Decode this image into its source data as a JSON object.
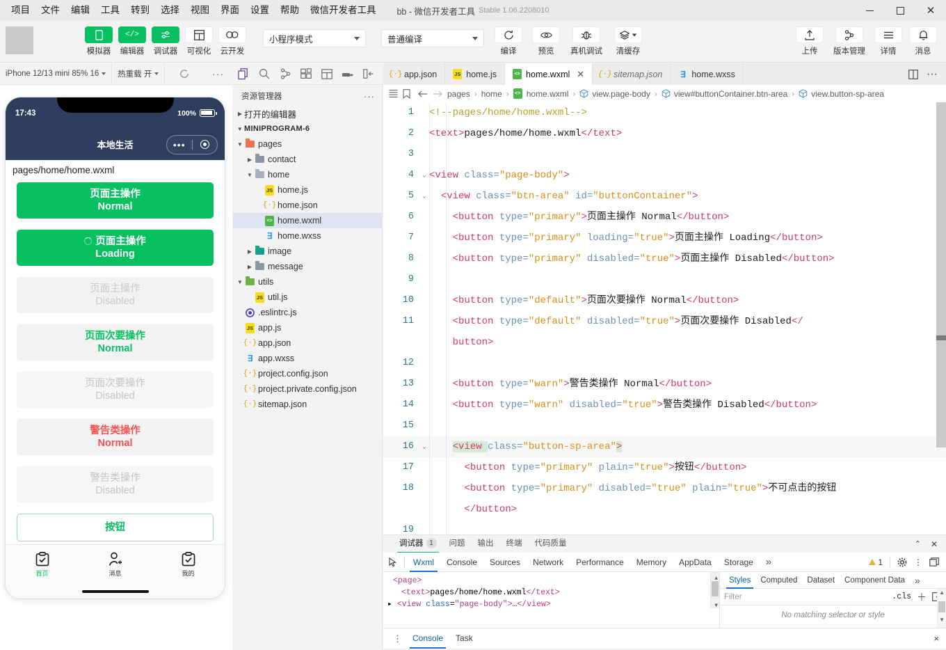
{
  "window": {
    "title": "bb - 微信开发者工具",
    "version": "Stable 1.06.2208010",
    "minimize": "minimize",
    "maximize": "maximize",
    "close": "close"
  },
  "menubar": {
    "items": [
      "项目",
      "文件",
      "编辑",
      "工具",
      "转到",
      "选择",
      "视图",
      "界面",
      "设置",
      "帮助",
      "微信开发者工具"
    ]
  },
  "toolbar": {
    "left_items": [
      {
        "label": "模拟器",
        "icon": "phone-icon",
        "style": "green"
      },
      {
        "label": "编辑器",
        "icon": "code-icon",
        "style": "green"
      },
      {
        "label": "调试器",
        "icon": "sliders-icon",
        "style": "green"
      },
      {
        "label": "可视化",
        "icon": "layout-icon",
        "style": "white"
      },
      {
        "label": "云开发",
        "icon": "cloud-icon",
        "style": "white"
      }
    ],
    "mode_select": "小程序模式",
    "compile_select": "普通编译",
    "mid_items": [
      {
        "label": "编译",
        "icon": "refresh-icon"
      },
      {
        "label": "预览",
        "icon": "eye-icon"
      },
      {
        "label": "真机调试",
        "icon": "bug-icon"
      },
      {
        "label": "清缓存",
        "icon": "layers-icon"
      }
    ],
    "right_items": [
      {
        "label": "上传",
        "icon": "upload-icon"
      },
      {
        "label": "版本管理",
        "icon": "branch-icon"
      },
      {
        "label": "详情",
        "icon": "menu-icon"
      },
      {
        "label": "消息",
        "icon": "bell-icon"
      }
    ]
  },
  "simulator": {
    "device_select": "iPhone 12/13 mini 85% 16",
    "hot_reload_select": "热重载 开",
    "refresh_icon": "refresh-icon",
    "more_icon": "ellipsis-icon",
    "status_time": "17:43",
    "battery_pct": "100%",
    "nav_title": "本地生活",
    "page_path": "pages/home/home.wxml",
    "buttons": [
      {
        "line1": "页面主操作",
        "line2": "Normal",
        "style": "primary",
        "loading": false
      },
      {
        "line1": "页面主操作",
        "line2": "Loading",
        "style": "primary",
        "loading": true
      },
      {
        "line1": "页面主操作",
        "line2": "Disabled",
        "style": "primary-dis",
        "loading": false
      },
      {
        "line1": "页面次要操作",
        "line2": "Normal",
        "style": "default",
        "loading": false
      },
      {
        "line1": "页面次要操作",
        "line2": "Disabled",
        "style": "default-dis",
        "loading": false
      },
      {
        "line1": "警告类操作",
        "line2": "Normal",
        "style": "warn",
        "loading": false
      },
      {
        "line1": "警告类操作",
        "line2": "Disabled",
        "style": "warn-dis",
        "loading": false
      }
    ],
    "plain_button": "按钮",
    "tabbar": [
      {
        "label": "首页",
        "icon": "clipboard-check-icon",
        "active": true
      },
      {
        "label": "消息",
        "icon": "person-add-icon",
        "active": false
      },
      {
        "label": "我的",
        "icon": "clipboard-check-icon",
        "active": false
      }
    ]
  },
  "activity_bar": {
    "icons": [
      "files-icon",
      "search-icon",
      "source-control-icon",
      "extensions-icon",
      "layout-panel-icon",
      "docker-icon",
      "sidebar-toggle-icon"
    ]
  },
  "explorer": {
    "title": "资源管理器",
    "more": "···",
    "open_editors": "打开的编辑器",
    "project_name": "MINIPROGRAM-6",
    "tree": [
      {
        "label": "pages",
        "depth": 1,
        "type": "folder",
        "color": "f-red",
        "expanded": true
      },
      {
        "label": "contact",
        "depth": 2,
        "type": "folder",
        "color": "f-gray",
        "expanded": false
      },
      {
        "label": "home",
        "depth": 2,
        "type": "folder",
        "color": "f-lgray",
        "expanded": true
      },
      {
        "label": "home.js",
        "depth": 3,
        "type": "js"
      },
      {
        "label": "home.json",
        "depth": 3,
        "type": "json"
      },
      {
        "label": "home.wxml",
        "depth": 3,
        "type": "wxml",
        "selected": true
      },
      {
        "label": "home.wxss",
        "depth": 3,
        "type": "wxss"
      },
      {
        "label": "image",
        "depth": 2,
        "type": "folder",
        "color": "f-teal",
        "expanded": false
      },
      {
        "label": "message",
        "depth": 2,
        "type": "folder",
        "color": "f-gray",
        "expanded": false
      },
      {
        "label": "utils",
        "depth": 1,
        "type": "folder",
        "color": "f-green",
        "expanded": true
      },
      {
        "label": "util.js",
        "depth": 2,
        "type": "js"
      },
      {
        "label": ".eslintrc.js",
        "depth": 1,
        "type": "eslint"
      },
      {
        "label": "app.js",
        "depth": 1,
        "type": "js"
      },
      {
        "label": "app.json",
        "depth": 1,
        "type": "json"
      },
      {
        "label": "app.wxss",
        "depth": 1,
        "type": "wxss"
      },
      {
        "label": "project.config.json",
        "depth": 1,
        "type": "json"
      },
      {
        "label": "project.private.config.json",
        "depth": 1,
        "type": "json"
      },
      {
        "label": "sitemap.json",
        "depth": 1,
        "type": "json"
      }
    ]
  },
  "editor": {
    "tabs": [
      {
        "label": "app.json",
        "type": "json",
        "active": false,
        "italic": false,
        "closable": false
      },
      {
        "label": "home.js",
        "type": "js",
        "active": false,
        "italic": false,
        "closable": false
      },
      {
        "label": "home.wxml",
        "type": "wxml",
        "active": true,
        "italic": false,
        "closable": true
      },
      {
        "label": "sitemap.json",
        "type": "json",
        "active": false,
        "italic": true,
        "closable": false
      },
      {
        "label": "home.wxss",
        "type": "wxss",
        "active": false,
        "italic": false,
        "closable": false
      }
    ],
    "tab_actions": [
      "split-editor-icon",
      "more-actions-icon"
    ],
    "breadcrumb_icons": [
      "outline-icon",
      "bookmark-icon",
      "back-arrow-icon",
      "forward-arrow-icon"
    ],
    "breadcrumb": [
      "pages",
      "home",
      "home.wxml",
      "view.page-body",
      "view#buttonContainer.btn-area",
      "view.button-sp-area"
    ],
    "lines": [
      {
        "num": "1",
        "fold": "",
        "tokens": [
          {
            "t": "comment",
            "v": "<!--pages/home/home.wxml-->"
          }
        ]
      },
      {
        "num": "2",
        "fold": "",
        "tokens": [
          {
            "t": "tag",
            "v": "<text>"
          },
          {
            "t": "text",
            "v": "pages/home/home.wxml"
          },
          {
            "t": "tag",
            "v": "</text>"
          }
        ]
      },
      {
        "num": "3",
        "fold": "",
        "tokens": []
      },
      {
        "num": "4",
        "fold": "v",
        "tokens": [
          {
            "t": "tag",
            "v": "<view "
          },
          {
            "t": "attr",
            "v": "class="
          },
          {
            "t": "str",
            "v": "\"page-body\""
          },
          {
            "t": "tag",
            "v": ">"
          }
        ]
      },
      {
        "num": "5",
        "fold": "v",
        "indent": 1,
        "tokens": [
          {
            "t": "tag",
            "v": "<view "
          },
          {
            "t": "attr",
            "v": "class="
          },
          {
            "t": "str",
            "v": "\"btn-area\""
          },
          {
            "t": "attr",
            "v": " id="
          },
          {
            "t": "str",
            "v": "\"buttonContainer\""
          },
          {
            "t": "tag",
            "v": ">"
          }
        ]
      },
      {
        "num": "6",
        "fold": "",
        "indent": 2,
        "tokens": [
          {
            "t": "tag",
            "v": "<button "
          },
          {
            "t": "attr",
            "v": "type="
          },
          {
            "t": "str",
            "v": "\"primary\""
          },
          {
            "t": "tag",
            "v": ">"
          },
          {
            "t": "text",
            "v": "页面主操作 Normal"
          },
          {
            "t": "tag",
            "v": "</button>"
          }
        ]
      },
      {
        "num": "7",
        "fold": "",
        "indent": 2,
        "tokens": [
          {
            "t": "tag",
            "v": "<button "
          },
          {
            "t": "attr",
            "v": "type="
          },
          {
            "t": "str",
            "v": "\"primary\""
          },
          {
            "t": "attr",
            "v": " loading="
          },
          {
            "t": "str",
            "v": "\"true\""
          },
          {
            "t": "tag",
            "v": ">"
          },
          {
            "t": "text",
            "v": "页面主操作 Loading"
          },
          {
            "t": "tag",
            "v": "</button>"
          }
        ]
      },
      {
        "num": "8",
        "fold": "",
        "indent": 2,
        "tokens": [
          {
            "t": "tag",
            "v": "<button "
          },
          {
            "t": "attr",
            "v": "type="
          },
          {
            "t": "str",
            "v": "\"primary\""
          },
          {
            "t": "attr",
            "v": " disabled="
          },
          {
            "t": "str",
            "v": "\"true\""
          },
          {
            "t": "tag",
            "v": ">"
          },
          {
            "t": "text",
            "v": "页面主操作 Disabled"
          },
          {
            "t": "tag",
            "v": "</button>"
          }
        ]
      },
      {
        "num": "9",
        "fold": "",
        "indent": 2,
        "tokens": []
      },
      {
        "num": "10",
        "fold": "",
        "indent": 2,
        "tokens": [
          {
            "t": "tag",
            "v": "<button "
          },
          {
            "t": "attr",
            "v": "type="
          },
          {
            "t": "str",
            "v": "\"default\""
          },
          {
            "t": "tag",
            "v": ">"
          },
          {
            "t": "text",
            "v": "页面次要操作 Normal"
          },
          {
            "t": "tag",
            "v": "</button>"
          }
        ]
      },
      {
        "num": "11",
        "fold": "",
        "indent": 2,
        "wrap": true,
        "tokens": [
          {
            "t": "tag",
            "v": "<button "
          },
          {
            "t": "attr",
            "v": "type="
          },
          {
            "t": "str",
            "v": "\"default\""
          },
          {
            "t": "attr",
            "v": " disabled="
          },
          {
            "t": "str",
            "v": "\"true\""
          },
          {
            "t": "tag",
            "v": ">"
          },
          {
            "t": "text",
            "v": "页面次要操作 Disabled"
          },
          {
            "t": "tag",
            "v": "</"
          }
        ],
        "tokens2": [
          {
            "t": "tag",
            "v": "button>"
          }
        ]
      },
      {
        "num": "12",
        "fold": "",
        "indent": 2,
        "tokens": []
      },
      {
        "num": "13",
        "fold": "",
        "indent": 2,
        "tokens": [
          {
            "t": "tag",
            "v": "<button "
          },
          {
            "t": "attr",
            "v": "type="
          },
          {
            "t": "str",
            "v": "\"warn\""
          },
          {
            "t": "tag",
            "v": ">"
          },
          {
            "t": "text",
            "v": "警告类操作 Normal"
          },
          {
            "t": "tag",
            "v": "</button>"
          }
        ]
      },
      {
        "num": "14",
        "fold": "",
        "indent": 2,
        "tokens": [
          {
            "t": "tag",
            "v": "<button "
          },
          {
            "t": "attr",
            "v": "type="
          },
          {
            "t": "str",
            "v": "\"warn\""
          },
          {
            "t": "attr",
            "v": " disabled="
          },
          {
            "t": "str",
            "v": "\"true\""
          },
          {
            "t": "tag",
            "v": ">"
          },
          {
            "t": "text",
            "v": "警告类操作 Disabled"
          },
          {
            "t": "tag",
            "v": "</button>"
          }
        ]
      },
      {
        "num": "15",
        "fold": "",
        "indent": 2,
        "tokens": []
      },
      {
        "num": "16",
        "fold": "v",
        "indent": 2,
        "current": true,
        "tokens": [
          {
            "t": "tag",
            "v": "<view "
          },
          {
            "t": "attr",
            "v": "class="
          },
          {
            "t": "str",
            "v": "\"button-sp-area\""
          },
          {
            "t": "tag",
            "v": ">"
          }
        ]
      },
      {
        "num": "17",
        "fold": "",
        "indent": 3,
        "tokens": [
          {
            "t": "tag",
            "v": "<button "
          },
          {
            "t": "attr",
            "v": "type="
          },
          {
            "t": "str",
            "v": "\"primary\""
          },
          {
            "t": "attr",
            "v": " plain="
          },
          {
            "t": "str",
            "v": "\"true\""
          },
          {
            "t": "tag",
            "v": ">"
          },
          {
            "t": "text",
            "v": "按钮"
          },
          {
            "t": "tag",
            "v": "</button>"
          }
        ]
      },
      {
        "num": "18",
        "fold": "",
        "indent": 3,
        "wrap": true,
        "tokens": [
          {
            "t": "tag",
            "v": "<button "
          },
          {
            "t": "attr",
            "v": "type="
          },
          {
            "t": "str",
            "v": "\"primary\""
          },
          {
            "t": "attr",
            "v": " disabled="
          },
          {
            "t": "str",
            "v": "\"true\""
          },
          {
            "t": "attr",
            "v": " plain="
          },
          {
            "t": "str",
            "v": "\"true\""
          },
          {
            "t": "tag",
            "v": ">"
          },
          {
            "t": "text",
            "v": "不可点击的按钮"
          }
        ],
        "tokens2": [
          {
            "t": "tag",
            "v": "</button>"
          }
        ]
      },
      {
        "num": "19",
        "fold": "",
        "indent": 3,
        "tokens": []
      }
    ]
  },
  "debugger": {
    "panel_tabs": [
      {
        "label": "调试器",
        "badge": "1",
        "active": true
      },
      {
        "label": "问题",
        "badge": "",
        "active": false
      },
      {
        "label": "输出",
        "badge": "",
        "active": false
      },
      {
        "label": "终端",
        "badge": "",
        "active": false
      },
      {
        "label": "代码质量",
        "badge": "",
        "active": false
      }
    ],
    "panel_actions": [
      "collapse-icon",
      "close-icon"
    ],
    "devtools_tabs": [
      "Wxml",
      "Console",
      "Sources",
      "Network",
      "Performance",
      "Memory",
      "AppData",
      "Storage"
    ],
    "devtools_active": "Wxml",
    "devtools_overflow": "»",
    "inspect_icon": "inspect-icon",
    "warning_count": "1",
    "devtools_right_icons": [
      "settings-gear-icon",
      "more-vertical-icon",
      "dock-icon",
      "devtools-close-icon"
    ],
    "wxml_tree": [
      {
        "indent": 0,
        "tokens": [
          {
            "t": "tag",
            "v": "<page>"
          }
        ]
      },
      {
        "indent": 1,
        "tokens": [
          {
            "t": "tag",
            "v": "<text>"
          },
          {
            "t": "text",
            "v": "pages/home/home.wxml"
          },
          {
            "t": "tag",
            "v": "</text>"
          }
        ]
      },
      {
        "indent": 0,
        "arrow": true,
        "tokens": [
          {
            "t": "tag",
            "v": "<view "
          },
          {
            "t": "attr",
            "v": "class"
          },
          {
            "t": "text",
            "v": "="
          },
          {
            "t": "str",
            "v": "\"page-body\""
          },
          {
            "t": "tag",
            "v": ">"
          },
          {
            "t": "text",
            "v": "…"
          },
          {
            "t": "tag",
            "v": "</view>"
          }
        ]
      }
    ],
    "styles_tabs": [
      "Styles",
      "Computed",
      "Dataset",
      "Component Data"
    ],
    "styles_active": "Styles",
    "styles_overflow": "»",
    "filter_placeholder": "Filter",
    "cls_label": ".cls",
    "add_rule_icon": "plus-icon",
    "toggle_icon": "panel-toggle-icon",
    "no_style_text": "No matching selector or style",
    "console_tabs": [
      "Console",
      "Task"
    ],
    "console_active": "Console",
    "console_close": "×"
  },
  "colors": {
    "brand_green": "#07c160",
    "warn_red": "#fa5151",
    "phone_nav": "#2f3d5e",
    "accent_blue": "#1473c8"
  }
}
